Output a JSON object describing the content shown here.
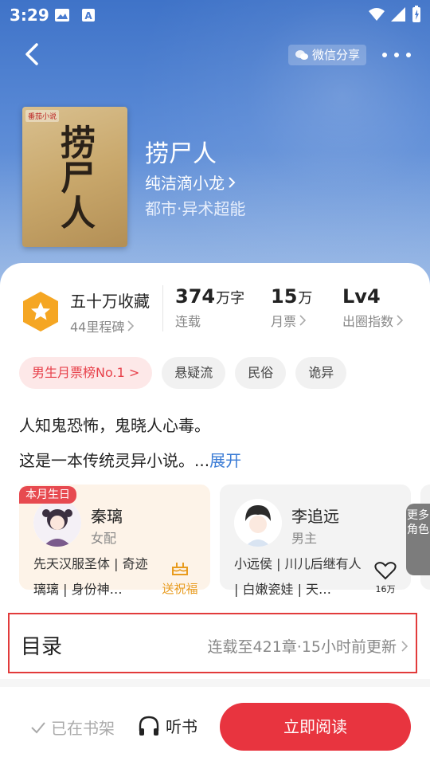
{
  "status_bar": {
    "time": "3:29"
  },
  "header": {
    "share_label": "微信分享"
  },
  "book": {
    "cover_brand": "番茄小说",
    "cover_title": "捞尸人",
    "title": "捞尸人",
    "author": "纯洁滴小龙",
    "genre": "都市·异术超能"
  },
  "stats": {
    "collect_value": "五十万收藏",
    "collect_sub": "44里程碑",
    "words_num": "374",
    "words_unit": "万字",
    "words_label": "连载",
    "tickets_num": "15",
    "tickets_unit": "万",
    "tickets_label": "月票",
    "level_num": "Lv4",
    "level_label": "出圈指数"
  },
  "tags": [
    "男生月票榜No.1 >",
    "悬疑流",
    "民俗",
    "诡异"
  ],
  "intro": {
    "line1": "人知鬼恐怖，鬼晓人心毒。",
    "line2": "这是一本传统灵异小说。",
    "ellipsis": "...",
    "expand": "展开"
  },
  "characters": [
    {
      "ribbon": "本月生日",
      "name": "秦璃",
      "role": "女配",
      "desc": "先天汉服圣体 | 奇迹璃璃 | 身份神…",
      "action": "送祝福"
    },
    {
      "name": "李追远",
      "role": "男主",
      "desc": "小远侯 | 川儿后继有人 | 白嫩瓷娃 | 天…",
      "likes": "16万"
    }
  ],
  "more_roles": "更多角色",
  "toc": {
    "title": "目录",
    "status": "连载至421章·15小时前更新"
  },
  "bottom": {
    "shelf": "已在书架",
    "listen": "听书",
    "read": "立即阅读"
  },
  "colors": {
    "accent": "#e8343f",
    "link": "#3a7bd5",
    "hero": "#4a7cd0",
    "badge": "#f5a623"
  }
}
